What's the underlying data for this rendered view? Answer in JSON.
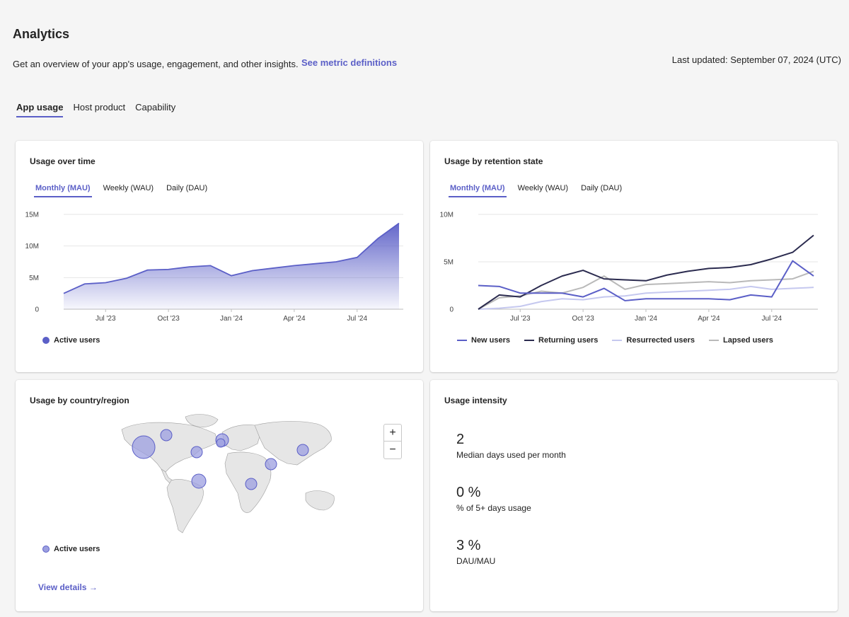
{
  "header": {
    "title": "Analytics",
    "subtitle": "Get an overview of your app's usage, engagement, and other insights.",
    "defs_link": "See metric definitions",
    "last_updated": "Last updated: September 07, 2024 (UTC)"
  },
  "tabs": [
    {
      "label": "App usage",
      "active": true
    },
    {
      "label": "Host product",
      "active": false
    },
    {
      "label": "Capability",
      "active": false
    }
  ],
  "colors": {
    "accent": "#5b5fc7",
    "new_users": "#5b5fc7",
    "returning_users": "#2b2b4f",
    "resurrected_users": "#c5c8ef",
    "lapsed_users": "#b9b9b9"
  },
  "usage_over_time": {
    "title": "Usage over time",
    "subtabs": [
      "Monthly (MAU)",
      "Weekly (WAU)",
      "Daily (DAU)"
    ],
    "legend": "Active users"
  },
  "retention": {
    "title": "Usage by retention state",
    "subtabs": [
      "Monthly (MAU)",
      "Weekly (WAU)",
      "Daily (DAU)"
    ],
    "legend": [
      "New users",
      "Returning users",
      "Resurrected users",
      "Lapsed users"
    ]
  },
  "country": {
    "title": "Usage by country/region",
    "legend": "Active users",
    "zoom_in": "+",
    "zoom_out": "−",
    "view_details": "View details →"
  },
  "intensity": {
    "title": "Usage intensity",
    "metrics": [
      {
        "value": "2",
        "label": "Median days used per month"
      },
      {
        "value": "0 %",
        "label": "% of 5+ days usage"
      },
      {
        "value": "3 %",
        "label": "DAU/MAU"
      }
    ]
  },
  "chart_data": [
    {
      "type": "area",
      "title": "Usage over time",
      "xlabel": "",
      "ylabel": "",
      "x_ticks": [
        "Jul '23",
        "Oct '23",
        "Jan '24",
        "Apr '24",
        "Jul '24"
      ],
      "y_ticks": [
        "0",
        "5M",
        "10M",
        "15M"
      ],
      "ylim": [
        0,
        15000000
      ],
      "grid": true,
      "legend": "bottom-left",
      "series": [
        {
          "name": "Active users",
          "x": [
            "2023-05",
            "2023-06",
            "2023-07",
            "2023-08",
            "2023-09",
            "2023-10",
            "2023-11",
            "2023-12",
            "2024-01",
            "2024-02",
            "2024-03",
            "2024-04",
            "2024-05",
            "2024-06",
            "2024-07",
            "2024-08",
            "2024-09"
          ],
          "values": [
            2500000,
            4000000,
            4200000,
            4900000,
            6200000,
            6300000,
            6700000,
            6900000,
            5300000,
            6100000,
            6500000,
            6900000,
            7200000,
            7500000,
            8200000,
            11200000,
            13600000
          ]
        }
      ]
    },
    {
      "type": "line",
      "title": "Usage by retention state",
      "xlabel": "",
      "ylabel": "",
      "x_ticks": [
        "Jul '23",
        "Oct '23",
        "Jan '24",
        "Apr '24",
        "Jul '24"
      ],
      "y_ticks": [
        "0",
        "5M",
        "10M"
      ],
      "ylim": [
        0,
        10000000
      ],
      "grid": true,
      "legend": "bottom",
      "x": [
        "2023-05",
        "2023-06",
        "2023-07",
        "2023-08",
        "2023-09",
        "2023-10",
        "2023-11",
        "2023-12",
        "2024-01",
        "2024-02",
        "2024-03",
        "2024-04",
        "2024-05",
        "2024-06",
        "2024-07",
        "2024-08",
        "2024-09"
      ],
      "series": [
        {
          "name": "New users",
          "values": [
            2500000,
            2400000,
            1700000,
            1700000,
            1700000,
            1300000,
            2200000,
            900000,
            1100000,
            1100000,
            1100000,
            1100000,
            1000000,
            1500000,
            1300000,
            5100000,
            3500000
          ]
        },
        {
          "name": "Returning users",
          "values": [
            0,
            1500000,
            1300000,
            2500000,
            3500000,
            4100000,
            3200000,
            3100000,
            3000000,
            3600000,
            4000000,
            4300000,
            4400000,
            4700000,
            5300000,
            6000000,
            7800000
          ]
        },
        {
          "name": "Resurrected users",
          "values": [
            0,
            100000,
            300000,
            800000,
            1100000,
            1000000,
            1300000,
            1400000,
            1700000,
            1800000,
            1900000,
            2000000,
            2100000,
            2400000,
            2100000,
            2200000,
            2300000
          ]
        },
        {
          "name": "Lapsed users",
          "values": [
            0,
            1200000,
            1400000,
            1900000,
            1700000,
            2300000,
            3500000,
            2100000,
            2600000,
            2700000,
            2800000,
            2900000,
            2800000,
            3000000,
            3100000,
            3200000,
            4000000
          ]
        }
      ]
    }
  ]
}
